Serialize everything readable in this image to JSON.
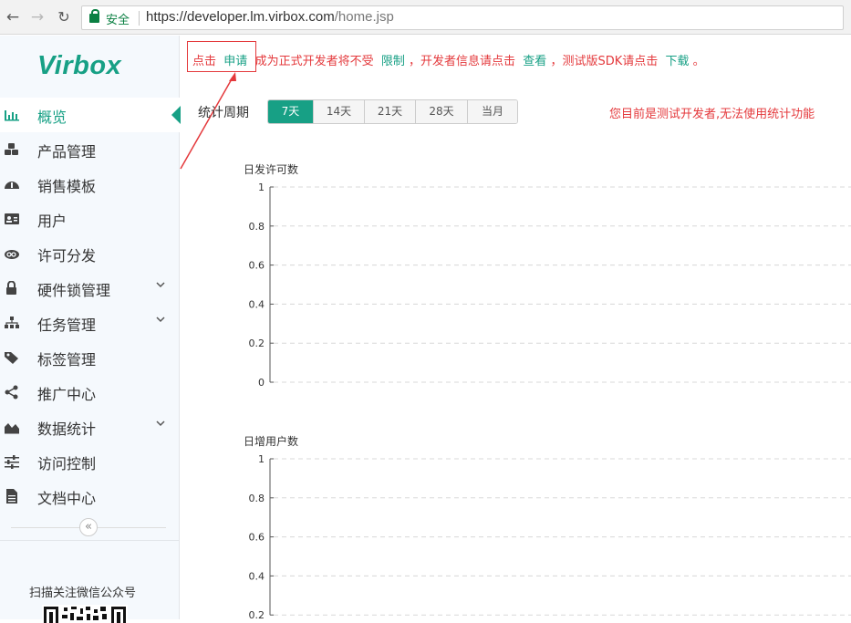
{
  "browser": {
    "secure_label": "安全",
    "url_scheme_host": "https://developer.lm.virbox.com",
    "url_path": "/home.jsp"
  },
  "sidebar": {
    "logo": "Virbox",
    "items": [
      {
        "label": "概览",
        "icon": "bar-chart-icon",
        "active": true
      },
      {
        "label": "产品管理",
        "icon": "cubes-icon"
      },
      {
        "label": "销售模板",
        "icon": "dashboard-icon"
      },
      {
        "label": "用户",
        "icon": "id-card-icon"
      },
      {
        "label": "许可分发",
        "icon": "cloud-icon"
      },
      {
        "label": "硬件锁管理",
        "icon": "lock-icon",
        "has_submenu": true
      },
      {
        "label": "任务管理",
        "icon": "sitemap-icon",
        "has_submenu": true
      },
      {
        "label": "标签管理",
        "icon": "tags-icon"
      },
      {
        "label": "推广中心",
        "icon": "share-icon"
      },
      {
        "label": "数据统计",
        "icon": "area-chart-icon",
        "has_submenu": true
      },
      {
        "label": "访问控制",
        "icon": "sliders-icon"
      },
      {
        "label": "文档中心",
        "icon": "document-icon"
      }
    ],
    "collapse_glyph": "«",
    "qr_label": "扫描关注微信公众号"
  },
  "notice": {
    "part1": "点击",
    "link1": "申请",
    "part2": "成为正式开发者将不受",
    "link2": "限制",
    "part3": "，开发者信息请点击",
    "link3": "查看",
    "part4": "，测试版SDK请点击",
    "link4": "下载",
    "part5": "。"
  },
  "period": {
    "label": "统计周期",
    "tabs": [
      "7天",
      "14天",
      "21天",
      "28天",
      "当月"
    ],
    "active": "7天"
  },
  "warning": "您目前是测试开发者,无法使用统计功能",
  "colors": {
    "accent": "#17a085",
    "alert": "#e4393c"
  },
  "chart_data": [
    {
      "type": "line",
      "title": "日发许可数",
      "yticks": [
        "1",
        "0.8",
        "0.6",
        "0.4",
        "0.2",
        "0"
      ],
      "ylim": [
        0,
        1
      ],
      "grid": true,
      "series": []
    },
    {
      "type": "line",
      "title": "日增用户数",
      "yticks": [
        "1",
        "0.8",
        "0.6",
        "0.4",
        "0.2"
      ],
      "ylim": [
        0,
        1
      ],
      "grid": true,
      "series": []
    }
  ]
}
